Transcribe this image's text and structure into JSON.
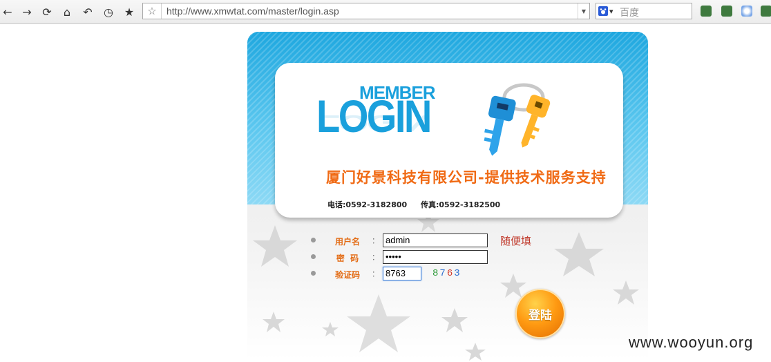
{
  "browser": {
    "url": "http://www.xmwtat.com/master/login.asp",
    "search_placeholder": "百度",
    "nav_icons": [
      "back-icon",
      "forward-icon",
      "reload-icon",
      "home-icon",
      "undo-icon",
      "history-icon",
      "bookmark-star-icon"
    ]
  },
  "banner": {
    "logo_top": "MEMBER",
    "logo_main": "LOGIN",
    "company": "厦门好景科技有限公司-提供技术服务支持",
    "phone": "电话:0592-3182800",
    "fax": "传真:0592-3182500"
  },
  "form": {
    "username_label": "用户名",
    "username_value": "admin",
    "username_hint": "随便填",
    "password_label": "密  码",
    "password_value": "•••••",
    "captcha_label": "验证码",
    "captcha_input": "8763",
    "captcha_digits": [
      {
        "d": "8",
        "color": "#2e9a3a"
      },
      {
        "d": "7",
        "color": "#2e6fd0"
      },
      {
        "d": "6",
        "color": "#d23a2a"
      },
      {
        "d": "3",
        "color": "#2e6fd0"
      }
    ],
    "colon": "：",
    "submit_label": "登陆"
  },
  "watermark": "www.wooyun.org"
}
